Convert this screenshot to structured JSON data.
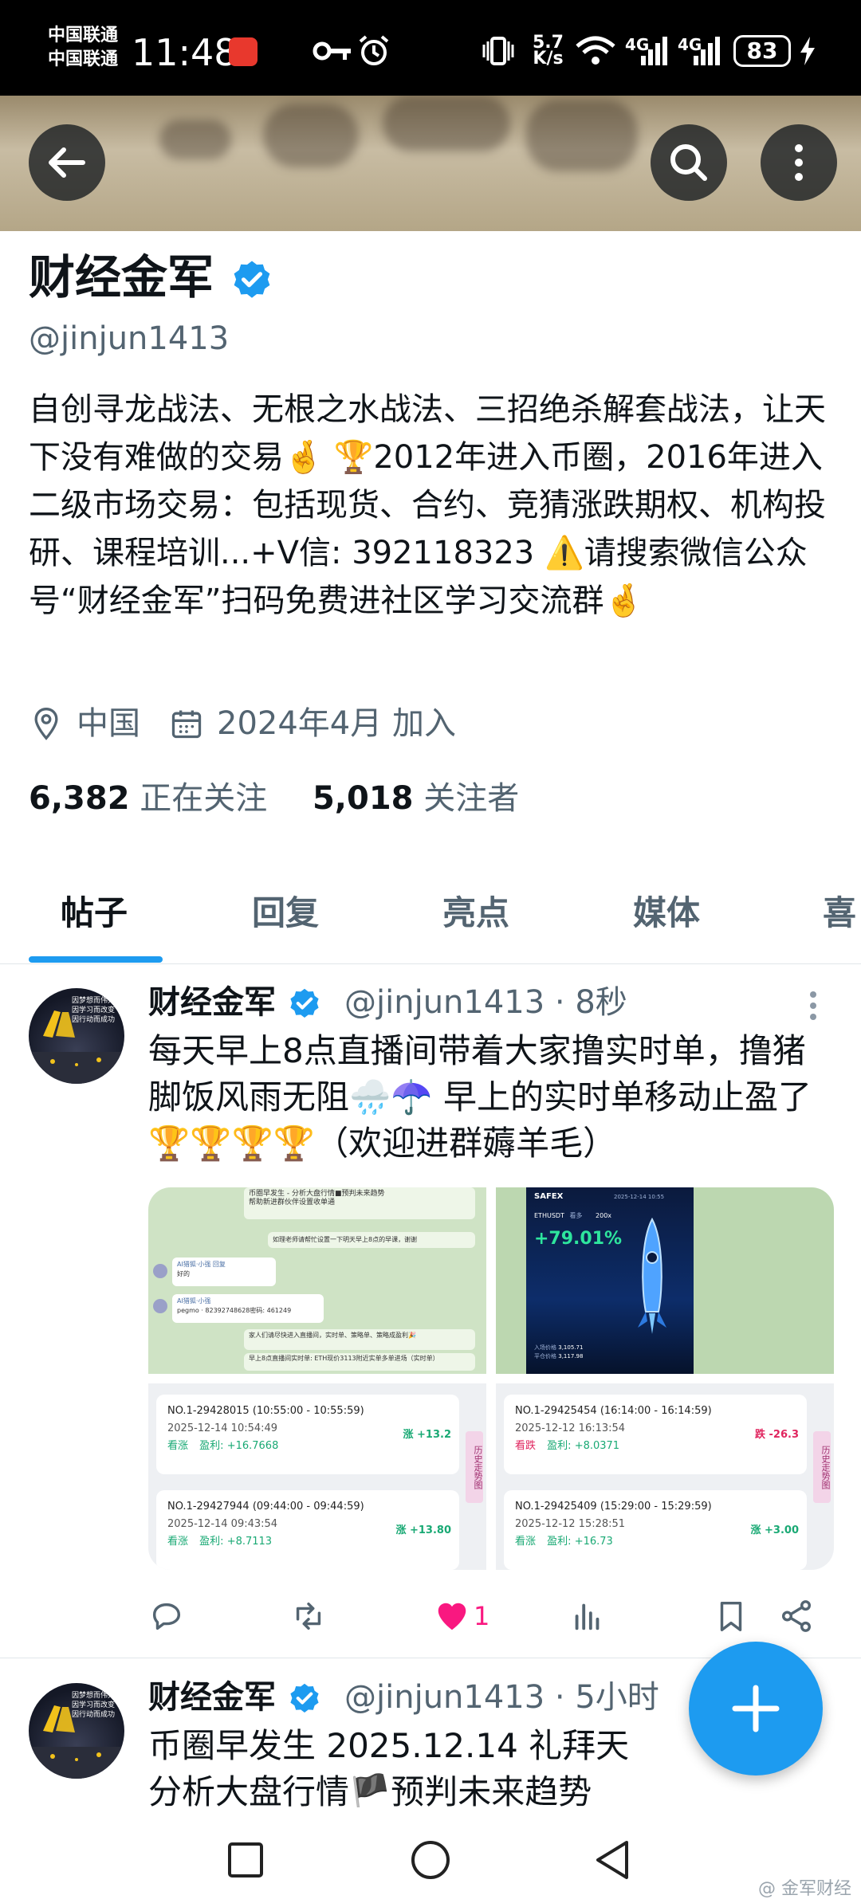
{
  "status_bar": {
    "carrier1": "中国联通",
    "carrier2": "中国联通",
    "time": "11:48",
    "speed_top": "5.7",
    "speed_bottom": "K/s",
    "net1": "4G",
    "net2": "4G",
    "battery": "83"
  },
  "profile": {
    "name": "财经金军",
    "handle": "@jinjun1413",
    "bio": "自创寻龙战法、无根之水战法、三招绝杀解套战法，让天下没有难做的交易🤞 🏆2012年进入币圈，2016年进入二级市场交易：包括现货、合约、竞猜涨跌期权、机构投研、课程培训...+V信: 392118323 ⚠️请搜索微信公众号“财经金军”扫码免费进社区学习交流群🤞",
    "location": "中国",
    "joined": "2024年4月 加入",
    "following_count": "6,382",
    "following_label": "正在关注",
    "followers_count": "5,018",
    "followers_label": "关注者"
  },
  "tabs": [
    "帖子",
    "回复",
    "亮点",
    "媒体",
    "喜"
  ],
  "posts": [
    {
      "name": "财经金军",
      "handle": "@jinjun1413 · 8秒",
      "text": "每天早上8点直播间带着大家撸实时单，撸猪脚饭风雨无阻🌧️☂️ 早上的实时单移动止盈了🏆🏆🏆🏆（欢迎进群薅羊毛）",
      "likes": "1",
      "media": {
        "chat_lines": [
          "币圈早发生 - 分析大盘行情■预判未来趋势",
          "帮助新进群伙伴设置收单通",
          "如理老师请帮忙设置一下明天早上8点的早课，谢谢",
          "AI猎狐·小强 回复",
          "好的",
          "AI猎狐·小强",
          "pegmo · 82392748628密码: 461249",
          "家人们请尽快进入直播间，实时单、策略单、策略成盈利🎉",
          "早上8点直播间实时单: ETH现价3113附近实单多单进场（实时单）"
        ],
        "safex_logo": "SAFEX",
        "safex_pair": "ETHUSDT",
        "safex_side": "看多",
        "safex_leverage": "200x",
        "safex_pct": "+79.01%",
        "safex_entry_label": "入场价格",
        "safex_entry": "3,105.71",
        "safex_exit_label": "平仓价格",
        "safex_exit": "3,117.98",
        "safex_date": "2025-12-14 10:55",
        "orders_left": [
          {
            "id": "NO.1-29428015  (10:55:00 - 10:55:59)",
            "date": "2025-12-14 10:54:49",
            "dir": "看涨",
            "pl_label": "盈利:",
            "pl": "+16.7668",
            "change": "涨 +13.2"
          },
          {
            "id": "NO.1-29427944  (09:44:00 - 09:44:59)",
            "date": "2025-12-14 09:43:54",
            "dir": "看涨",
            "pl_label": "盈利:",
            "pl": "+8.7113",
            "change": "涨 +13.80"
          }
        ],
        "orders_right": [
          {
            "id": "NO.1-29425454  (16:14:00 - 16:14:59)",
            "date": "2025-12-12 16:13:54",
            "dir": "看跌",
            "pl_label": "盈利:",
            "pl": "+8.0371",
            "change": "跌 -26.3"
          },
          {
            "id": "NO.1-29425409  (15:29:00 - 15:29:59)",
            "date": "2025-12-12 15:28:51",
            "dir": "看涨",
            "pl_label": "盈利:",
            "pl": "+16.73",
            "change": "涨 +3.00"
          }
        ],
        "history_tag": "历史走势图"
      }
    },
    {
      "name": "财经金军",
      "handle": "@jinjun1413 · 5小时",
      "text_line1": "币圈早发生  2025.12.14  礼拜天",
      "text_line2": "分析大盘行情🏴预判未来趋势"
    }
  ],
  "avatar_text": "因梦想而伟大 因学习而改变 因行动而成功",
  "watermark": "@ 金军财经"
}
